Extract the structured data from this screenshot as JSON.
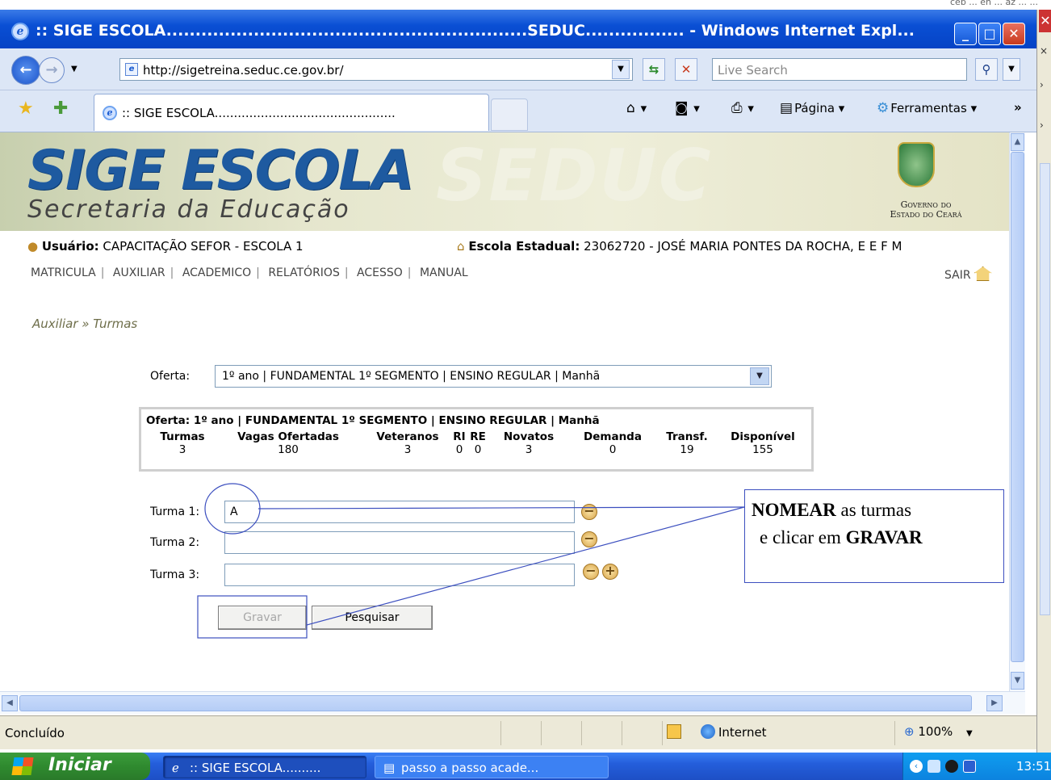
{
  "window": {
    "title": ":: SIGE ESCOLA..............................................................SEDUC................. - Windows Internet Expl...",
    "minimize": "_",
    "maximize": "□",
    "close": "✕"
  },
  "top_partial_text": "ceb ... en ... az ... ...",
  "address_bar": {
    "url": "http://sigetreina.seduc.ce.gov.br/",
    "search_placeholder": "Live Search"
  },
  "tabs": [
    {
      "label": ":: SIGE ESCOLA..............................................."
    }
  ],
  "command_bar": {
    "pagina": "Página",
    "ferramentas": "Ferramentas"
  },
  "header": {
    "logo": "SIGE ESCOLA",
    "subtitle": "Secretaria da Educação",
    "watermark": "SEDUC",
    "gov_line1": "Governo do",
    "gov_line2": "Estado do Ceará"
  },
  "user_info": {
    "user_label": "Usuário:",
    "user_value": "CAPACITAÇÃO SEFOR - ESCOLA 1",
    "school_label": "Escola Estadual:",
    "school_value": "23062720 - JOSÉ MARIA PONTES DA ROCHA, E E F M"
  },
  "menu": {
    "items": [
      "MATRICULA",
      "AUXILIAR",
      "ACADEMICO",
      "RELATÓRIOS",
      "ACESSO",
      "MANUAL"
    ],
    "logout": "SAIR"
  },
  "breadcrumb": "Auxiliar » Turmas",
  "form": {
    "oferta_label": "Oferta:",
    "oferta_value": "1º ano | FUNDAMENTAL 1º SEGMENTO | ENSINO REGULAR | Manhã",
    "summary": {
      "title": "Oferta: 1º ano | FUNDAMENTAL 1º SEGMENTO | ENSINO REGULAR | Manhã",
      "columns": [
        {
          "header": "Turmas",
          "value": "3"
        },
        {
          "header": "Vagas Ofertadas",
          "value": "180"
        },
        {
          "header": "Veteranos",
          "value": "3"
        },
        {
          "header": "RI",
          "value": "0"
        },
        {
          "header": "RE",
          "value": "0"
        },
        {
          "header": "Novatos",
          "value": "3"
        },
        {
          "header": "Demanda",
          "value": "0"
        },
        {
          "header": "Transf.",
          "value": "19"
        },
        {
          "header": "Disponível",
          "value": "155"
        }
      ]
    },
    "turmas": [
      {
        "label": "Turma 1:",
        "value": "A"
      },
      {
        "label": "Turma 2:",
        "value": ""
      },
      {
        "label": "Turma 3:",
        "value": ""
      }
    ],
    "gravar": "Gravar",
    "pesquisar": "Pesquisar"
  },
  "callout": {
    "line1_bold": "NOMEAR",
    "line1_rest": " as turmas",
    "line2_rest": "e clicar em ",
    "line2_bold": "GRAVAR"
  },
  "statusbar": {
    "status": "Concluído",
    "zone": "Internet",
    "zoom": "100%"
  },
  "taskbar": {
    "start": "Iniciar",
    "tasks": [
      ":: SIGE ESCOLA..........",
      "passo a passo acade..."
    ],
    "clock": "13:51"
  },
  "colors": {
    "titlebar": "#0a4fd4",
    "logo_blue": "#1e5aa0",
    "header_bg": "#e5e6cd",
    "annotation_blue": "#3c4fbf"
  }
}
